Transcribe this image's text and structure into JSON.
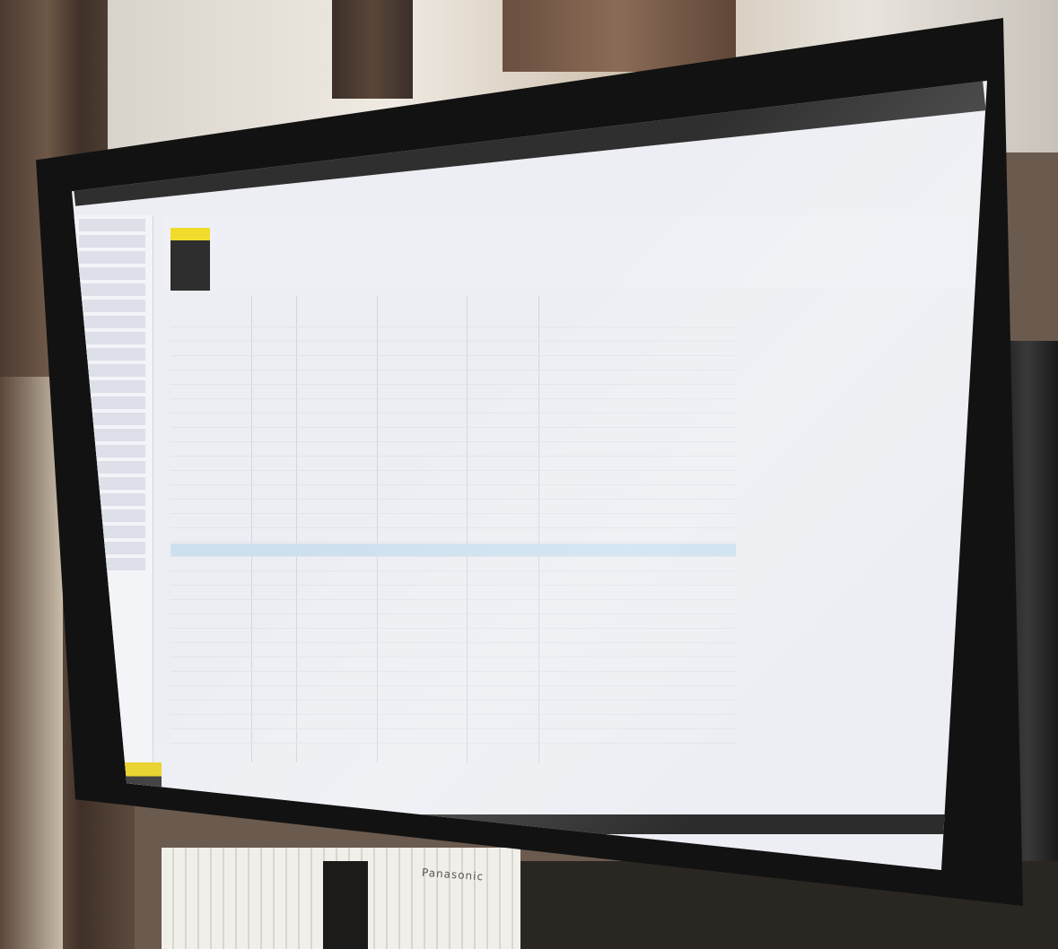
{
  "app": {
    "title": "",
    "search_placeholder": "",
    "tabs": [
      "",
      "",
      "",
      "",
      ""
    ]
  },
  "tracklist": {
    "columns": [
      "",
      "",
      "",
      "",
      "",
      ""
    ],
    "row_count": 30,
    "selected_row": 16
  },
  "monitor": {
    "brand": "Panasonic"
  },
  "colors": {
    "accent": "#e8d22a",
    "selection": "#cde0ef",
    "chrome": "#2f2f2f",
    "close": "#c0392b"
  },
  "icons": [
    "search-icon",
    "back-icon",
    "forward-icon",
    "play-icon",
    "close-icon",
    "minimize-icon",
    "maximize-icon"
  ]
}
